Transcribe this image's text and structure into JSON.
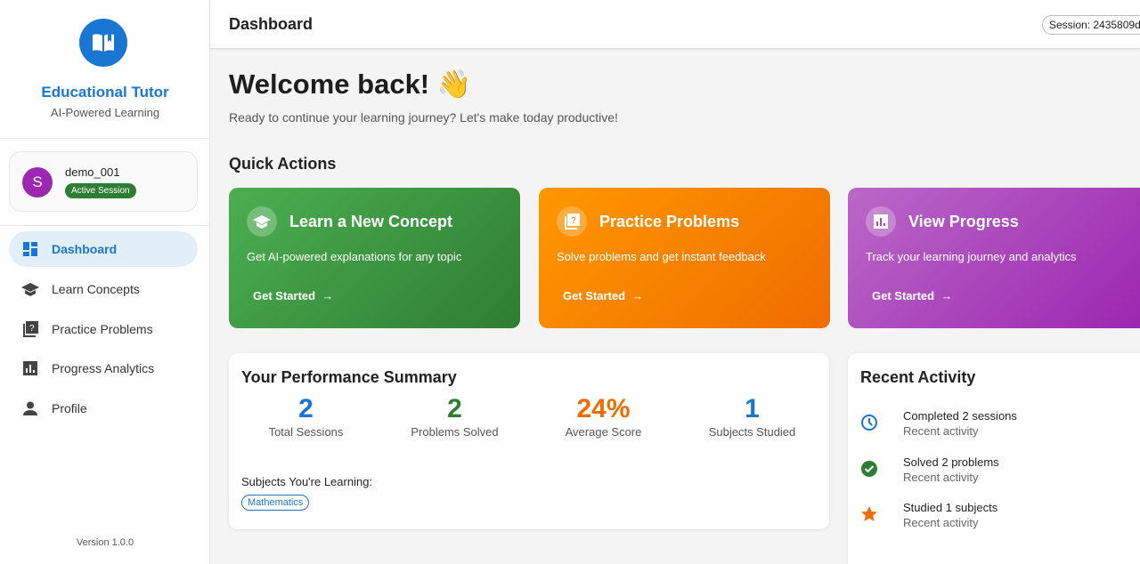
{
  "sidebar": {
    "brand": "Educational Tutor",
    "tagline": "AI-Powered Learning",
    "user": {
      "initial": "S",
      "name": "demo_001",
      "status": "Active Session"
    },
    "nav": [
      {
        "label": "Dashboard"
      },
      {
        "label": "Learn Concepts"
      },
      {
        "label": "Practice Problems"
      },
      {
        "label": "Progress Analytics"
      },
      {
        "label": "Profile"
      }
    ],
    "version": "Version 1.0.0"
  },
  "header": {
    "title": "Dashboard",
    "session": "Session: 2435809d"
  },
  "main": {
    "welcome": "Welcome back! 👋",
    "subtitle": "Ready to continue your learning journey? Let's make today productive!",
    "quick_actions_title": "Quick Actions",
    "cards": [
      {
        "title": "Learn a New Concept",
        "desc": "Get AI-powered explanations for any topic",
        "button": "Get Started"
      },
      {
        "title": "Practice Problems",
        "desc": "Solve problems and get instant feedback",
        "button": "Get Started"
      },
      {
        "title": "View Progress",
        "desc": "Track your learning journey and analytics",
        "button": "Get Started"
      }
    ],
    "summary": {
      "title": "Your Performance Summary",
      "stats": [
        {
          "value": "2",
          "label": "Total Sessions",
          "color": "#1976d2"
        },
        {
          "value": "2",
          "label": "Problems Solved",
          "color": "#2e7d32"
        },
        {
          "value": "24%",
          "label": "Average Score",
          "color": "#ef6c00"
        },
        {
          "value": "1",
          "label": "Subjects Studied",
          "color": "#1976d2"
        }
      ],
      "subjects_label": "Subjects You're Learning:",
      "subjects": [
        "Mathematics"
      ]
    },
    "activity": {
      "title": "Recent Activity",
      "items": [
        {
          "text": "Completed 2 sessions",
          "sub": "Recent activity"
        },
        {
          "text": "Solved 2 problems",
          "sub": "Recent activity"
        },
        {
          "text": "Studied 1 subjects",
          "sub": "Recent activity"
        }
      ]
    }
  }
}
